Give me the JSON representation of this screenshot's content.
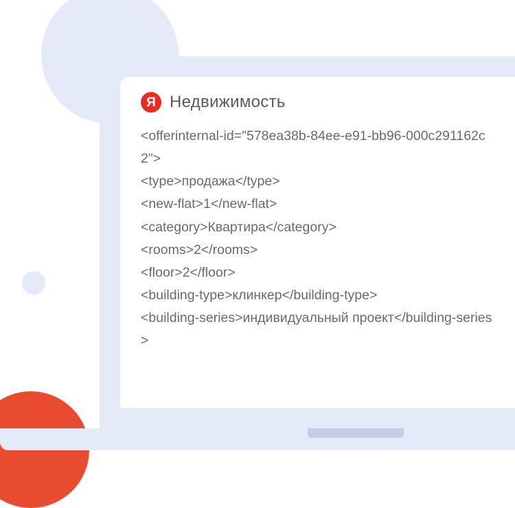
{
  "brand": {
    "badge_letter": "Я",
    "title": "Недвижимость"
  },
  "code": {
    "line1": "<offerinternal-id=\"578ea38b-84ee-e91-bb96-000c291162c2\">",
    "line2": "<type>продажа</type>",
    "line3": "<new-flat>1</new-flat>",
    "line4": "<category>Квартира</category>",
    "line5": "<rooms>2</rooms>",
    "line6": "<floor>2</floor>",
    "line7": "<building-type>клинкер</building-type>",
    "line8": "<building-series>индивидуальный проект</building-series>"
  }
}
